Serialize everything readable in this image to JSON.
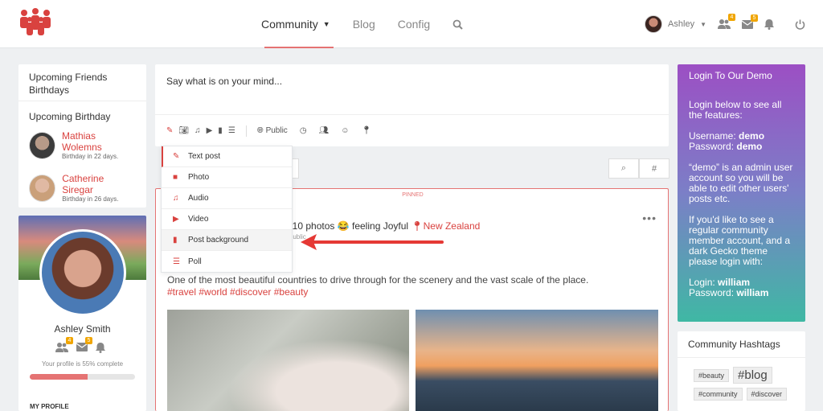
{
  "nav": {
    "items": [
      {
        "label": "Community",
        "active": true
      },
      {
        "label": "Blog"
      },
      {
        "label": "Config"
      }
    ],
    "user_name": "Ashley",
    "friends_badge": "4",
    "messages_badge": "5",
    "accent": "#d9423f"
  },
  "birthdays": {
    "title": "Upcoming Friends Birthdays",
    "subtitle": "Upcoming Birthday",
    "people": [
      {
        "name": "Mathias Wolemns",
        "when": "Birthday in 22 days."
      },
      {
        "name": "Catherine Siregar",
        "when": "Birthday in 26 days."
      }
    ]
  },
  "profile": {
    "name": "Ashley Smith",
    "friends_badge": "4",
    "messages_badge": "5",
    "complete_text": "Your profile is 55% complete",
    "complete_fraction": 0.55,
    "section": "MY PROFILE"
  },
  "composer": {
    "placeholder": "Say what is on your mind...",
    "privacy": "Public"
  },
  "post_types": [
    {
      "label": "Text post",
      "icon": "pencil-icon",
      "selected": true
    },
    {
      "label": "Photo",
      "icon": "camera-icon"
    },
    {
      "label": "Audio",
      "icon": "music-icon"
    },
    {
      "label": "Video",
      "icon": "video-icon"
    },
    {
      "label": "Post background",
      "icon": "paint-roller-icon",
      "hovered": true
    },
    {
      "label": "Poll",
      "icon": "list-icon"
    }
  ],
  "post": {
    "pinned": "PINNED",
    "action": "ed 10 photos 😂 feeling Joyful",
    "location": "New Zealand",
    "privacy": "Public",
    "text": "One of the most beautiful countries to drive through for the scenery and the vast scale of the place.",
    "tags": "#travel #world #discover #beauty"
  },
  "demo": {
    "title": "Login To Our Demo",
    "intro": "Login below to see all the features:",
    "username_label": "Username:",
    "username": "demo",
    "password_label": "Password:",
    "password": "demo",
    "note": "“demo” is an admin user account so you will be able to edit other users' posts etc.",
    "note2": "If you'd like to see a regular community member account, and a dark Gecko theme please login with:",
    "login_label": "Login:",
    "login": "william",
    "password2_label": "Password:",
    "password2": "william"
  },
  "hashtags": {
    "title": "Community Hashtags",
    "tags": [
      "#beauty",
      "#blog",
      "#community",
      "#discover"
    ]
  }
}
